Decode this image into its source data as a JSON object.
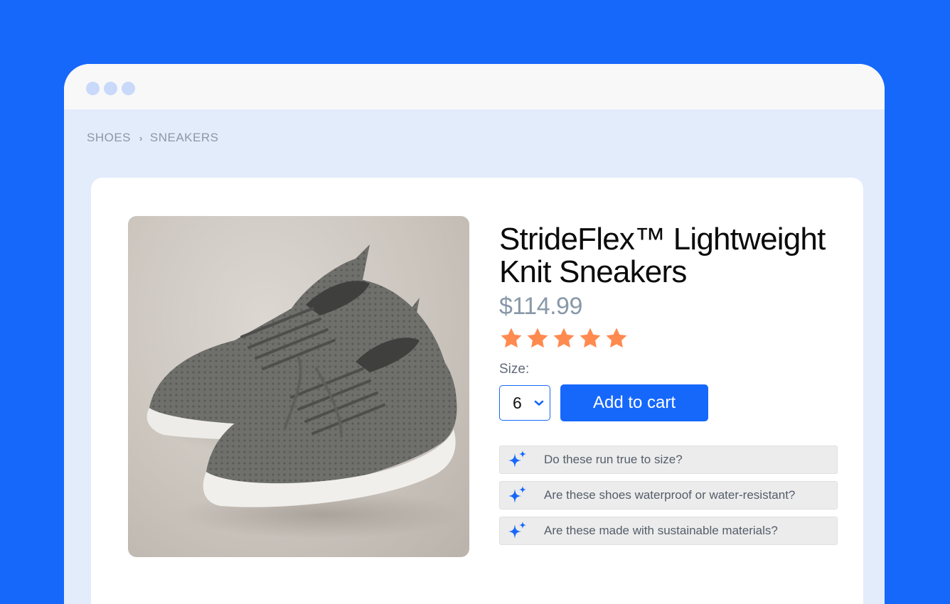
{
  "breadcrumb": {
    "items": [
      "SHOES",
      "SNEAKERS"
    ],
    "separator": "›"
  },
  "product": {
    "title": "StrideFlex™ Lightweight Knit Sneakers",
    "price": "$114.99",
    "rating": 5,
    "rating_max": 5,
    "image": "grey knit sneakers"
  },
  "size": {
    "label": "Size:",
    "selected": "6"
  },
  "cart": {
    "add_label": "Add to cart"
  },
  "suggested_questions": [
    "Do these run true to size?",
    "Are these shoes waterproof or water-resistant?",
    "Are these made with sustainable materials?"
  ],
  "colors": {
    "brand": "#1668fb",
    "star": "#ff8a50",
    "price": "#8898a8"
  },
  "icons": {
    "question": "sparkle-icon",
    "select": "chevron-down-icon"
  }
}
